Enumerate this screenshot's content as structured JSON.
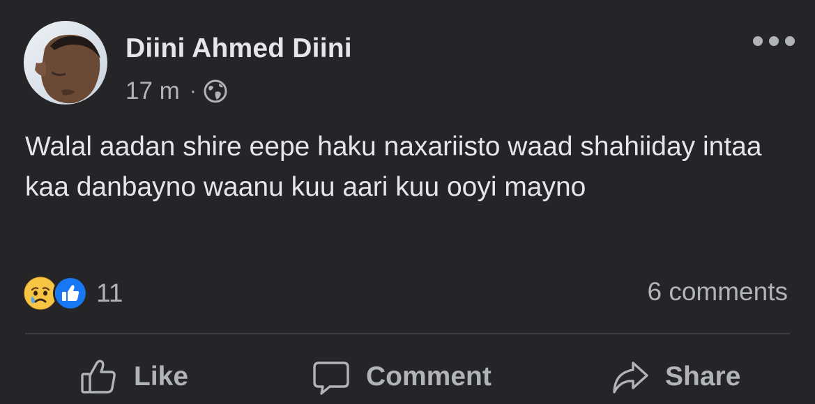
{
  "post": {
    "author": "Diini Ahmed Diini",
    "time": "17 m",
    "separator": "·",
    "audience_icon": "globe-icon",
    "text": "Walal aadan shire eepe haku naxariisto waad shahiiday intaa kaa danbayno waanu kuu aari kuu ooyi mayno",
    "reactions": {
      "icons": [
        "sad-reaction-icon",
        "like-reaction-icon"
      ],
      "count": "11"
    },
    "comments_count": "6 comments",
    "actions": {
      "like": "Like",
      "comment": "Comment",
      "share": "Share"
    }
  },
  "colors": {
    "background": "#252527",
    "primary_text": "#e4e6eb",
    "secondary_text": "#b0b3b8",
    "like_blue": "#1877f2",
    "divider": "#3e4042"
  }
}
